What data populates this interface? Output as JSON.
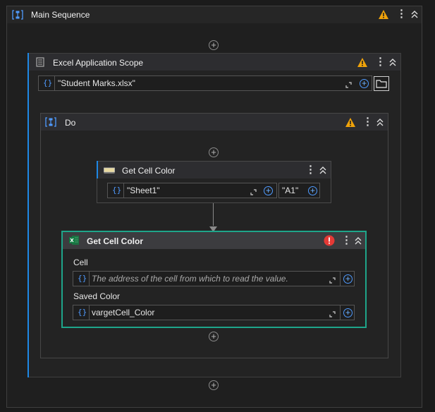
{
  "main_sequence": {
    "title": "Main Sequence",
    "icon": "sequence-icon"
  },
  "excel_scope": {
    "title": "Excel Application Scope",
    "file_value": "\"Student Marks.xlsx\""
  },
  "do_sequence": {
    "title": "Do"
  },
  "get_cell_color_1": {
    "title": "Get Cell Color",
    "sheet_value": "\"Sheet1\"",
    "cell_value": "\"A1\""
  },
  "get_cell_color_2": {
    "title": "Get Cell Color",
    "cell_label": "Cell",
    "cell_placeholder": "The address of the cell from which to read the value.",
    "saved_color_label": "Saved Color",
    "saved_color_value": "vargetCell_Color"
  },
  "colors": {
    "accent": "#1e88e5",
    "selected": "#1ea58a",
    "warning": "#f0a30a",
    "error": "#e53935"
  }
}
